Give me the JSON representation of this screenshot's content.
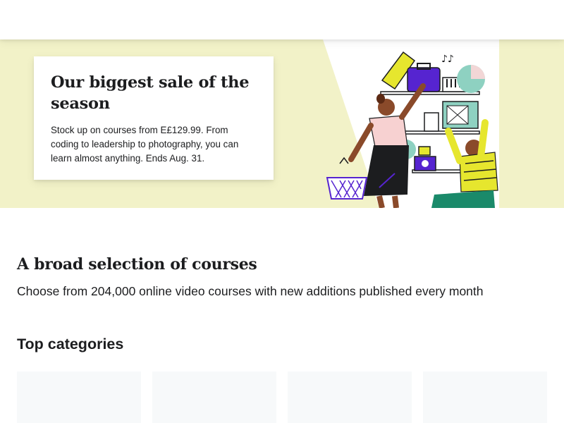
{
  "hero": {
    "title": "Our biggest sale of the season",
    "text": "Stock up on courses from E£129.99. From coding to leadership to photography, you can learn almost anything. Ends Aug. 31.",
    "background_color": "#f2f2c8",
    "illustration_icon": "shopping-sale-illustration"
  },
  "selection": {
    "title": "A broad selection of courses",
    "subtitle": "Choose from 204,000 online video courses with new additions published every month"
  },
  "categories": {
    "title": "Top categories",
    "cards": [
      {
        "label": ""
      },
      {
        "label": ""
      },
      {
        "label": ""
      },
      {
        "label": ""
      }
    ]
  },
  "colors": {
    "accent_purple": "#5624d0",
    "hero_yellow": "#f2f2c8",
    "card_placeholder": "#f7f9fa"
  }
}
